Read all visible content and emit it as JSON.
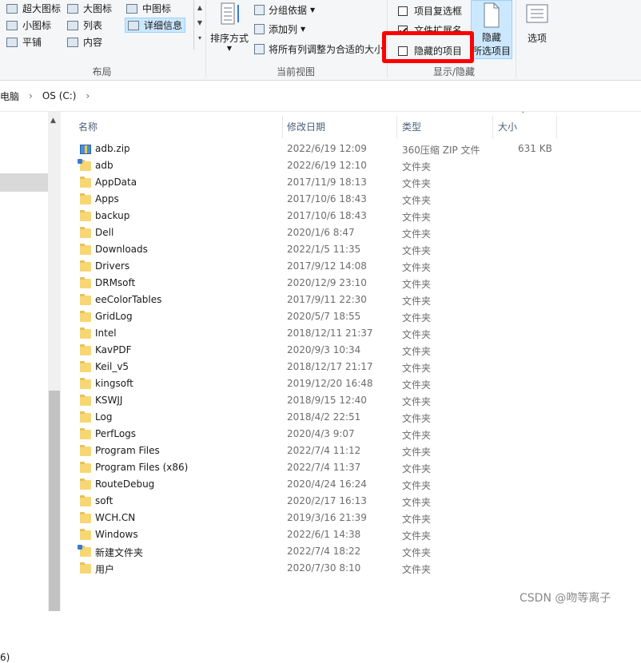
{
  "ribbon": {
    "layout": {
      "items": [
        "超大图标",
        "大图标",
        "中图标",
        "小图标",
        "列表",
        "详细信息",
        "平铺",
        "内容"
      ],
      "title": "布局"
    },
    "current_view": {
      "sort_label": "排序方式",
      "group_by": "分组依据",
      "add_column": "添加列",
      "fit_columns": "将所有列调整为合适的大小",
      "title": "当前视图"
    },
    "show_hide": {
      "item_checkboxes": "项目复选框",
      "file_extensions": "文件扩展名",
      "hidden_items": "隐藏的项目",
      "hide_label_1": "隐藏",
      "hide_label_2": "所选项目",
      "title": "显示/隐藏"
    },
    "options_label": "选项"
  },
  "address": {
    "parent": "电脑",
    "current": "OS (C:)"
  },
  "nav": {
    "partial_text": "6)"
  },
  "columns": {
    "name": "名称",
    "date": "修改日期",
    "type": "类型",
    "size": "大小"
  },
  "files": [
    {
      "name": "adb.zip",
      "date": "2022/6/19 12:09",
      "type": "360压缩 ZIP 文件",
      "size": "631 KB",
      "icon": "zip-icon"
    },
    {
      "name": "adb",
      "date": "2022/6/19 12:10",
      "type": "文件夹",
      "size": "",
      "icon": "folder-overlay-icon"
    },
    {
      "name": "AppData",
      "date": "2017/11/9 18:13",
      "type": "文件夹",
      "size": "",
      "icon": "folder-icon"
    },
    {
      "name": "Apps",
      "date": "2017/10/6 18:43",
      "type": "文件夹",
      "size": "",
      "icon": "folder-icon"
    },
    {
      "name": "backup",
      "date": "2017/10/6 18:43",
      "type": "文件夹",
      "size": "",
      "icon": "folder-icon"
    },
    {
      "name": "Dell",
      "date": "2020/1/6 8:47",
      "type": "文件夹",
      "size": "",
      "icon": "folder-icon"
    },
    {
      "name": "Downloads",
      "date": "2022/1/5 11:35",
      "type": "文件夹",
      "size": "",
      "icon": "folder-icon"
    },
    {
      "name": "Drivers",
      "date": "2017/9/12 14:08",
      "type": "文件夹",
      "size": "",
      "icon": "folder-icon"
    },
    {
      "name": "DRMsoft",
      "date": "2020/12/9 23:10",
      "type": "文件夹",
      "size": "",
      "icon": "folder-icon"
    },
    {
      "name": "eeColorTables",
      "date": "2017/9/11 22:30",
      "type": "文件夹",
      "size": "",
      "icon": "folder-icon"
    },
    {
      "name": "GridLog",
      "date": "2020/5/7 18:55",
      "type": "文件夹",
      "size": "",
      "icon": "folder-icon"
    },
    {
      "name": "Intel",
      "date": "2018/12/11 21:37",
      "type": "文件夹",
      "size": "",
      "icon": "folder-icon"
    },
    {
      "name": "KavPDF",
      "date": "2020/9/3 10:34",
      "type": "文件夹",
      "size": "",
      "icon": "folder-icon"
    },
    {
      "name": "Keil_v5",
      "date": "2018/12/17 21:17",
      "type": "文件夹",
      "size": "",
      "icon": "folder-icon"
    },
    {
      "name": "kingsoft",
      "date": "2019/12/20 16:48",
      "type": "文件夹",
      "size": "",
      "icon": "folder-icon"
    },
    {
      "name": "KSWJJ",
      "date": "2018/9/15 12:40",
      "type": "文件夹",
      "size": "",
      "icon": "folder-icon"
    },
    {
      "name": "Log",
      "date": "2018/4/2 22:51",
      "type": "文件夹",
      "size": "",
      "icon": "folder-icon"
    },
    {
      "name": "PerfLogs",
      "date": "2020/4/3 9:07",
      "type": "文件夹",
      "size": "",
      "icon": "folder-icon"
    },
    {
      "name": "Program Files",
      "date": "2022/7/4 11:12",
      "type": "文件夹",
      "size": "",
      "icon": "folder-icon"
    },
    {
      "name": "Program Files (x86)",
      "date": "2022/7/4 11:37",
      "type": "文件夹",
      "size": "",
      "icon": "folder-icon"
    },
    {
      "name": "RouteDebug",
      "date": "2020/4/24 16:24",
      "type": "文件夹",
      "size": "",
      "icon": "folder-icon"
    },
    {
      "name": "soft",
      "date": "2020/2/17 16:13",
      "type": "文件夹",
      "size": "",
      "icon": "folder-icon"
    },
    {
      "name": "WCH.CN",
      "date": "2019/3/16 21:39",
      "type": "文件夹",
      "size": "",
      "icon": "folder-icon"
    },
    {
      "name": "Windows",
      "date": "2022/6/1 14:38",
      "type": "文件夹",
      "size": "",
      "icon": "folder-icon"
    },
    {
      "name": "新建文件夹",
      "date": "2022/7/4 18:22",
      "type": "文件夹",
      "size": "",
      "icon": "folder-overlay-icon"
    },
    {
      "name": "用户",
      "date": "2020/7/30 8:10",
      "type": "文件夹",
      "size": "",
      "icon": "folder-icon"
    }
  ],
  "watermark": "CSDN @吻等离子",
  "colors": {
    "highlight": "#ff0000",
    "selected": "#cce8ff",
    "folder": "#f7d774"
  }
}
